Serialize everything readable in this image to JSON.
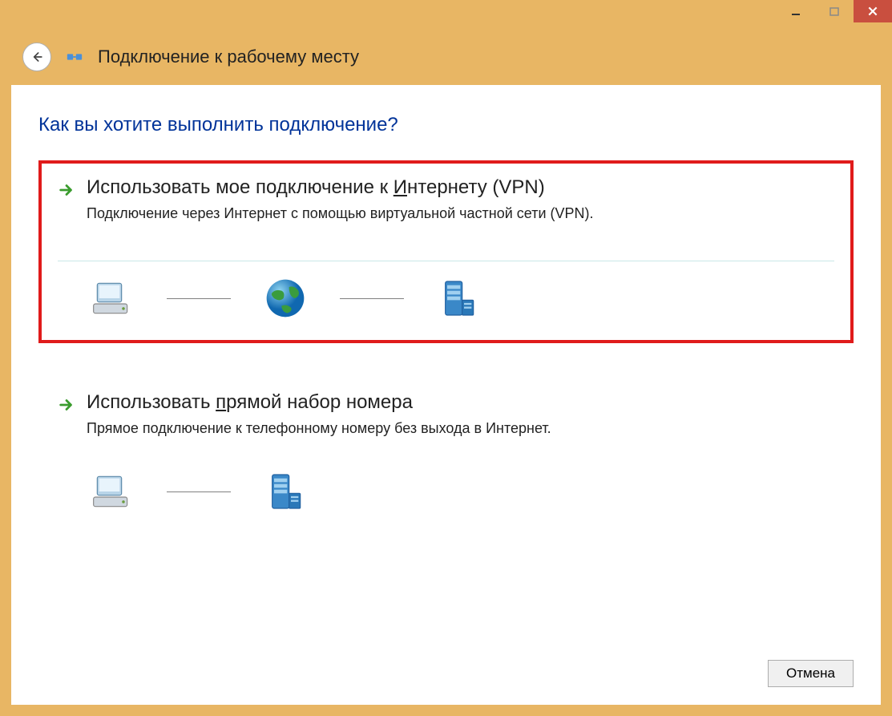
{
  "window": {
    "title": "Подключение к рабочему месту"
  },
  "question": "Как вы хотите выполнить подключение?",
  "options": {
    "vpn": {
      "title_pre": "Использовать мое подключение к ",
      "title_u": "И",
      "title_post": "нтернету (VPN)",
      "desc": "Подключение через Интернет с помощью виртуальной частной сети (VPN)."
    },
    "dial": {
      "title_pre": "Использовать ",
      "title_u": "п",
      "title_post": "рямой набор номера",
      "desc": "Прямое подключение к телефонному номеру без выхода в Интернет."
    }
  },
  "buttons": {
    "cancel": "Отмена"
  }
}
